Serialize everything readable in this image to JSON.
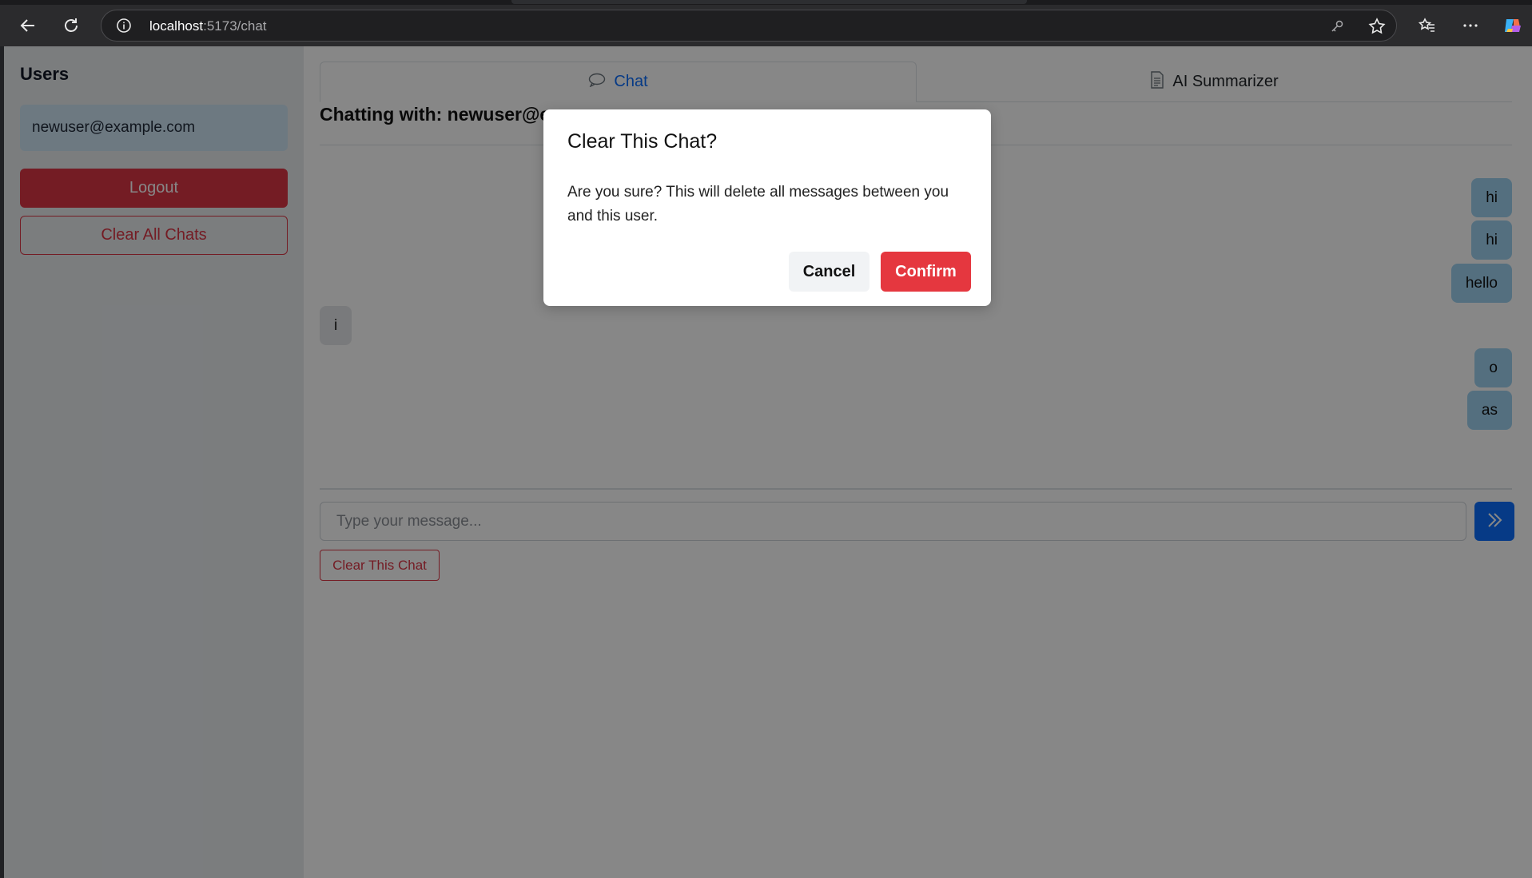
{
  "browser": {
    "url_host": "localhost",
    "url_rest": ":5173/chat"
  },
  "sidebar": {
    "title": "Users",
    "user": "newuser@example.com",
    "logout_label": "Logout",
    "clear_all_label": "Clear All Chats"
  },
  "main": {
    "tabs": [
      {
        "label": "Chat",
        "icon": "chat-bubble-icon"
      },
      {
        "label": "AI Summarizer",
        "icon": "document-icon"
      }
    ],
    "heading": "Chatting with: newuser@e",
    "messages": [
      {
        "text": "hi",
        "from": "me"
      },
      {
        "text": "hi",
        "from": "me"
      },
      {
        "text": "hello",
        "from": "me"
      },
      {
        "text": "i",
        "from": "them"
      },
      {
        "text": "o",
        "from": "me"
      },
      {
        "text": "as",
        "from": "me"
      }
    ],
    "input_placeholder": "Type your message...",
    "clear_this_label": "Clear This Chat"
  },
  "modal": {
    "title": "Clear This Chat?",
    "body": "Are you sure? This will delete all messages between you and this user.",
    "cancel_label": "Cancel",
    "confirm_label": "Confirm"
  },
  "colors": {
    "primary": "#0d6efd",
    "danger": "#dc3545",
    "confirm": "#e5373f",
    "bubble_mine": "#9fd2f0",
    "bubble_theirs": "#e5e7eb"
  }
}
